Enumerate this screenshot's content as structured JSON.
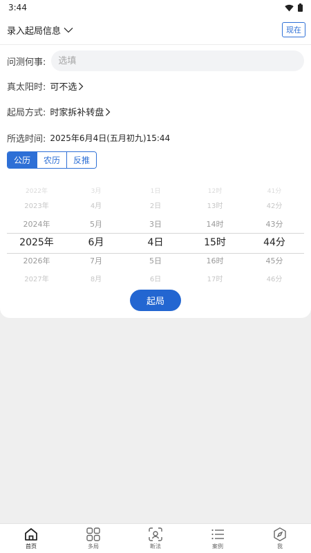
{
  "status": {
    "time": "3:44"
  },
  "header": {
    "title": "录入起局信息",
    "now_label": "现在"
  },
  "form": {
    "question_label": "问测何事:",
    "question_placeholder": "选填",
    "question_value": "",
    "solar_label": "真太阳时:",
    "solar_value": "可不选",
    "method_label": "起局方式:",
    "method_value": "时家拆补转盘",
    "time_label": "所选时间:",
    "time_value": "2025年6月4日(五月初九)15:44"
  },
  "calendar_tabs": [
    {
      "label": "公历",
      "active": true
    },
    {
      "label": "农历",
      "active": false
    },
    {
      "label": "反推",
      "active": false
    }
  ],
  "picker": {
    "columns": [
      {
        "name": "year",
        "items": [
          "2022年",
          "2023年",
          "2024年",
          "2025年",
          "2026年",
          "2027年"
        ]
      },
      {
        "name": "month",
        "items": [
          "3月",
          "4月",
          "5月",
          "6月",
          "7月",
          "8月"
        ]
      },
      {
        "name": "day",
        "items": [
          "1日",
          "2日",
          "3日",
          "4日",
          "5日",
          "6日"
        ]
      },
      {
        "name": "hour",
        "items": [
          "12时",
          "13时",
          "14时",
          "15时",
          "16时",
          "17时"
        ]
      },
      {
        "name": "minute",
        "items": [
          "41分",
          "42分",
          "43分",
          "44分",
          "45分",
          "46分"
        ]
      }
    ],
    "selected_index": 3
  },
  "start_label": "起局",
  "tabbar": [
    {
      "label": "首页",
      "icon": "home-icon",
      "active": true
    },
    {
      "label": "多局",
      "icon": "grid-icon",
      "active": false
    },
    {
      "label": "断法",
      "icon": "scan-icon",
      "active": false
    },
    {
      "label": "案例",
      "icon": "list-icon",
      "active": false
    },
    {
      "label": "我",
      "icon": "compass-icon",
      "active": false
    }
  ]
}
